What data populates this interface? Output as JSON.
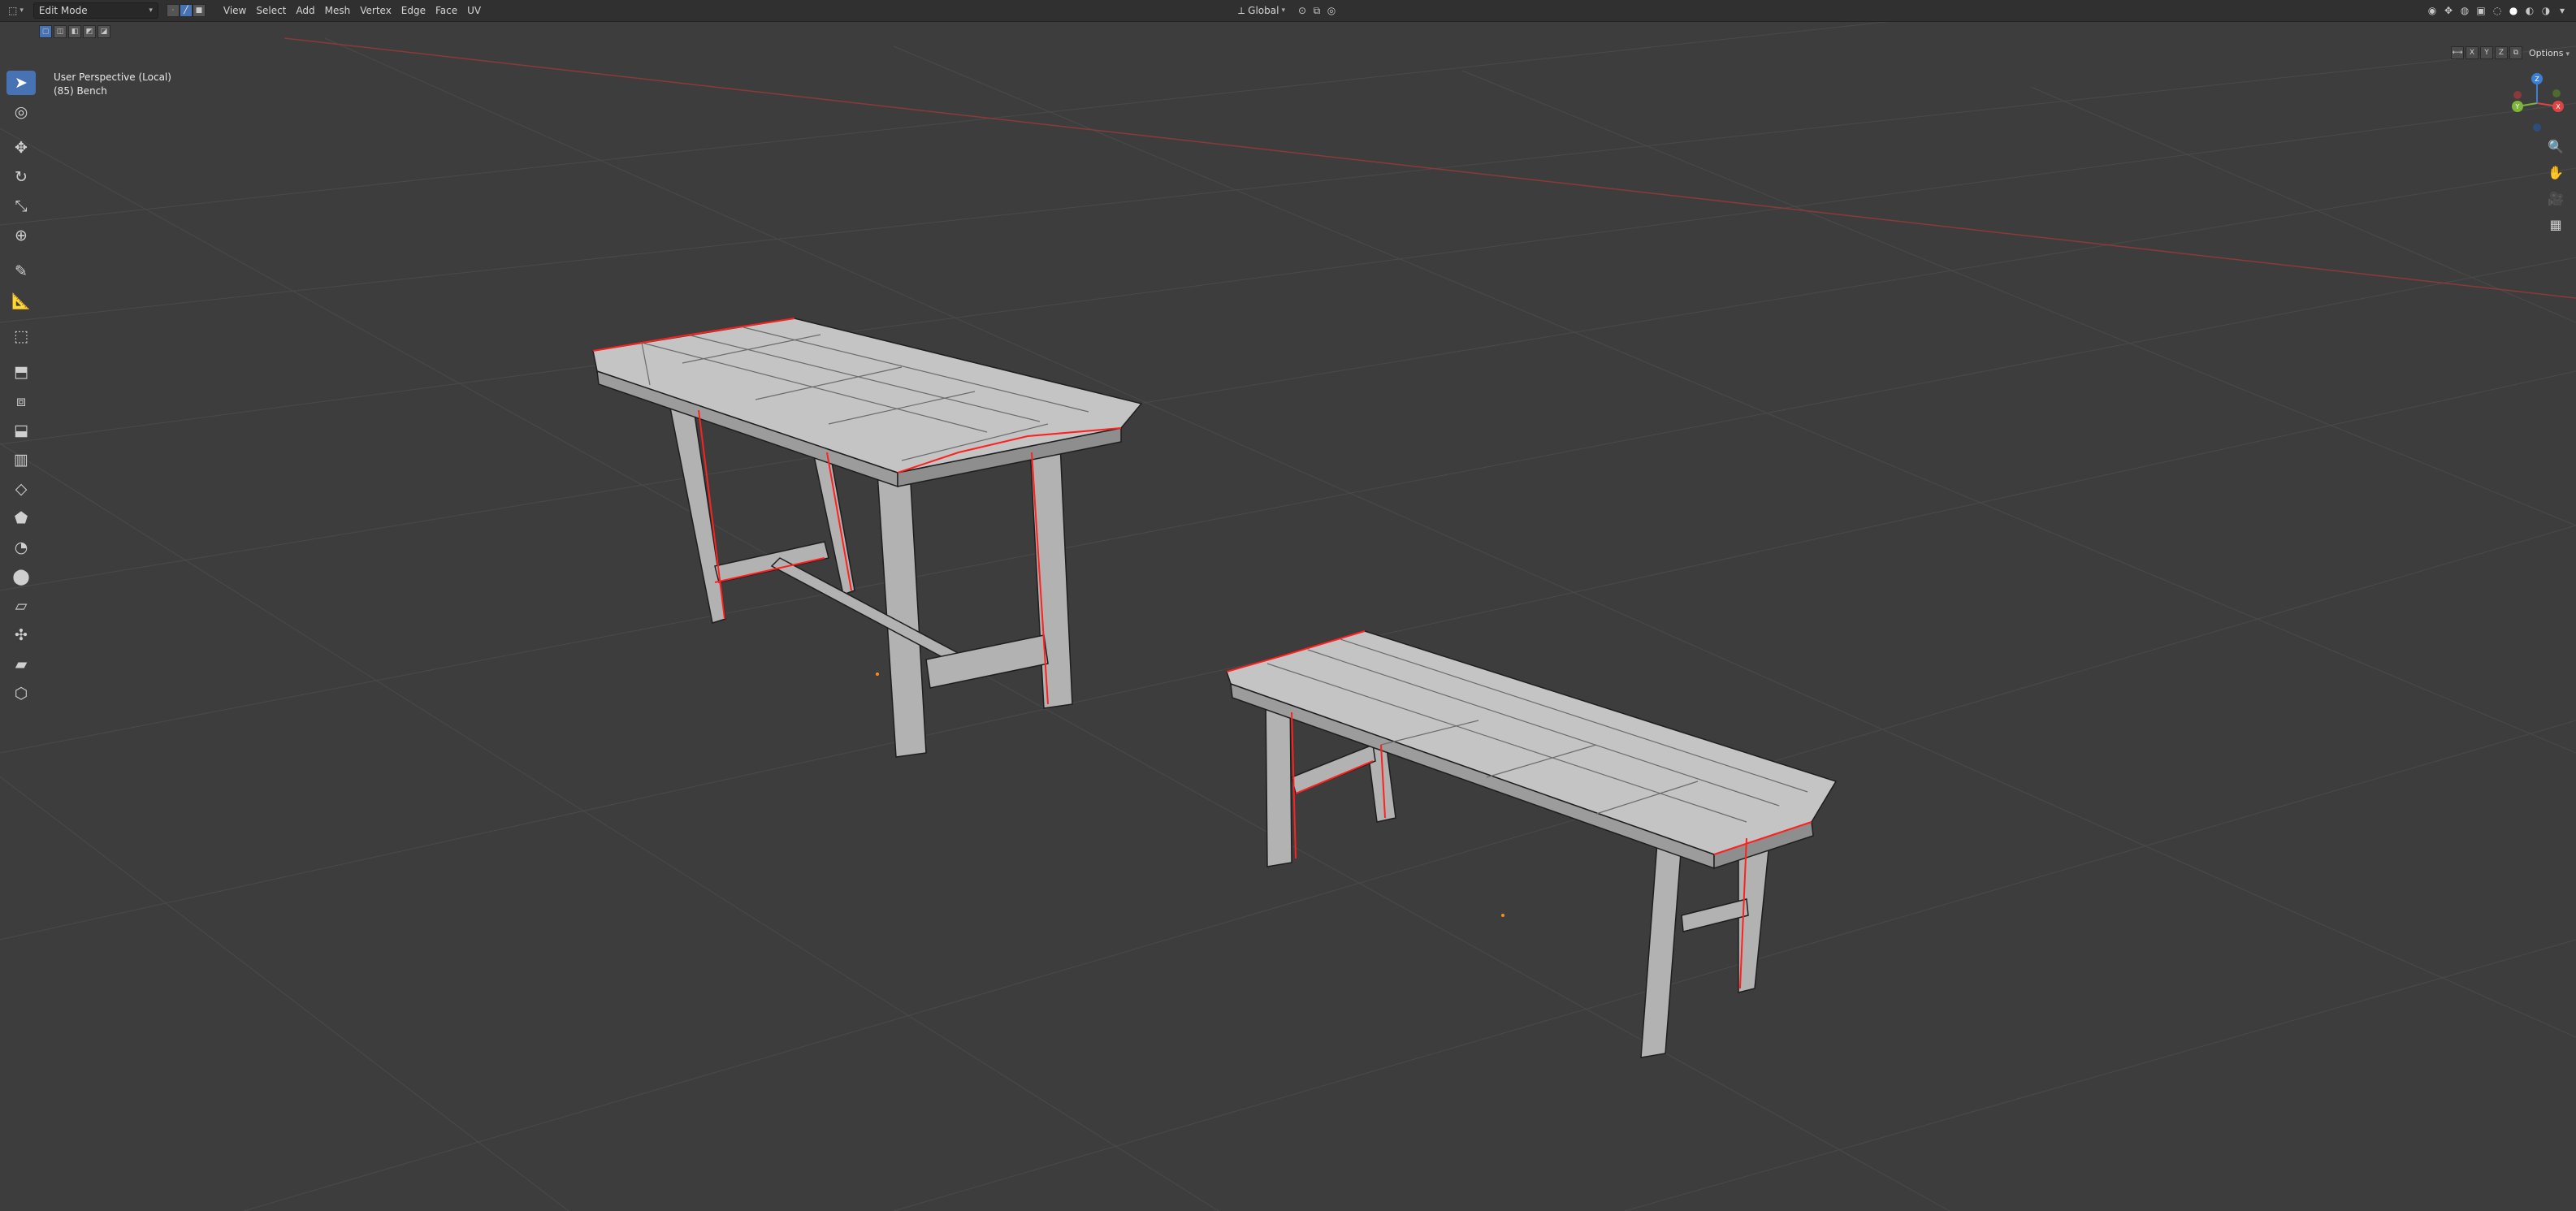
{
  "header": {
    "editor_type_icon": "cube-icon",
    "mode": "Edit Mode",
    "menus": [
      "View",
      "Select",
      "Add",
      "Mesh",
      "Vertex",
      "Edge",
      "Face",
      "UV"
    ],
    "transform_orientation": "Global",
    "right_icons": [
      "transform-pivot-icon",
      "snapping-icon",
      "proportional-edit-icon",
      "visibility-icon",
      "gizmo-icon",
      "overlay-icon",
      "xray-icon",
      "solid-shading-icon",
      "material-shading-icon",
      "rendered-shading-icon"
    ]
  },
  "viewport": {
    "perspective_label": "User Perspective (Local)",
    "object_label": "(85) Bench",
    "mirror_axes": [
      "X",
      "Y",
      "Z"
    ],
    "options_label": "Options"
  },
  "gizmo": {
    "x": "X",
    "y": "Y",
    "z": "Z"
  },
  "colors": {
    "bg": "#3d3d3d",
    "header": "#303030",
    "accent": "#4772b3",
    "seam": "#ff2a2a",
    "mesh": "#b5b5b5"
  }
}
